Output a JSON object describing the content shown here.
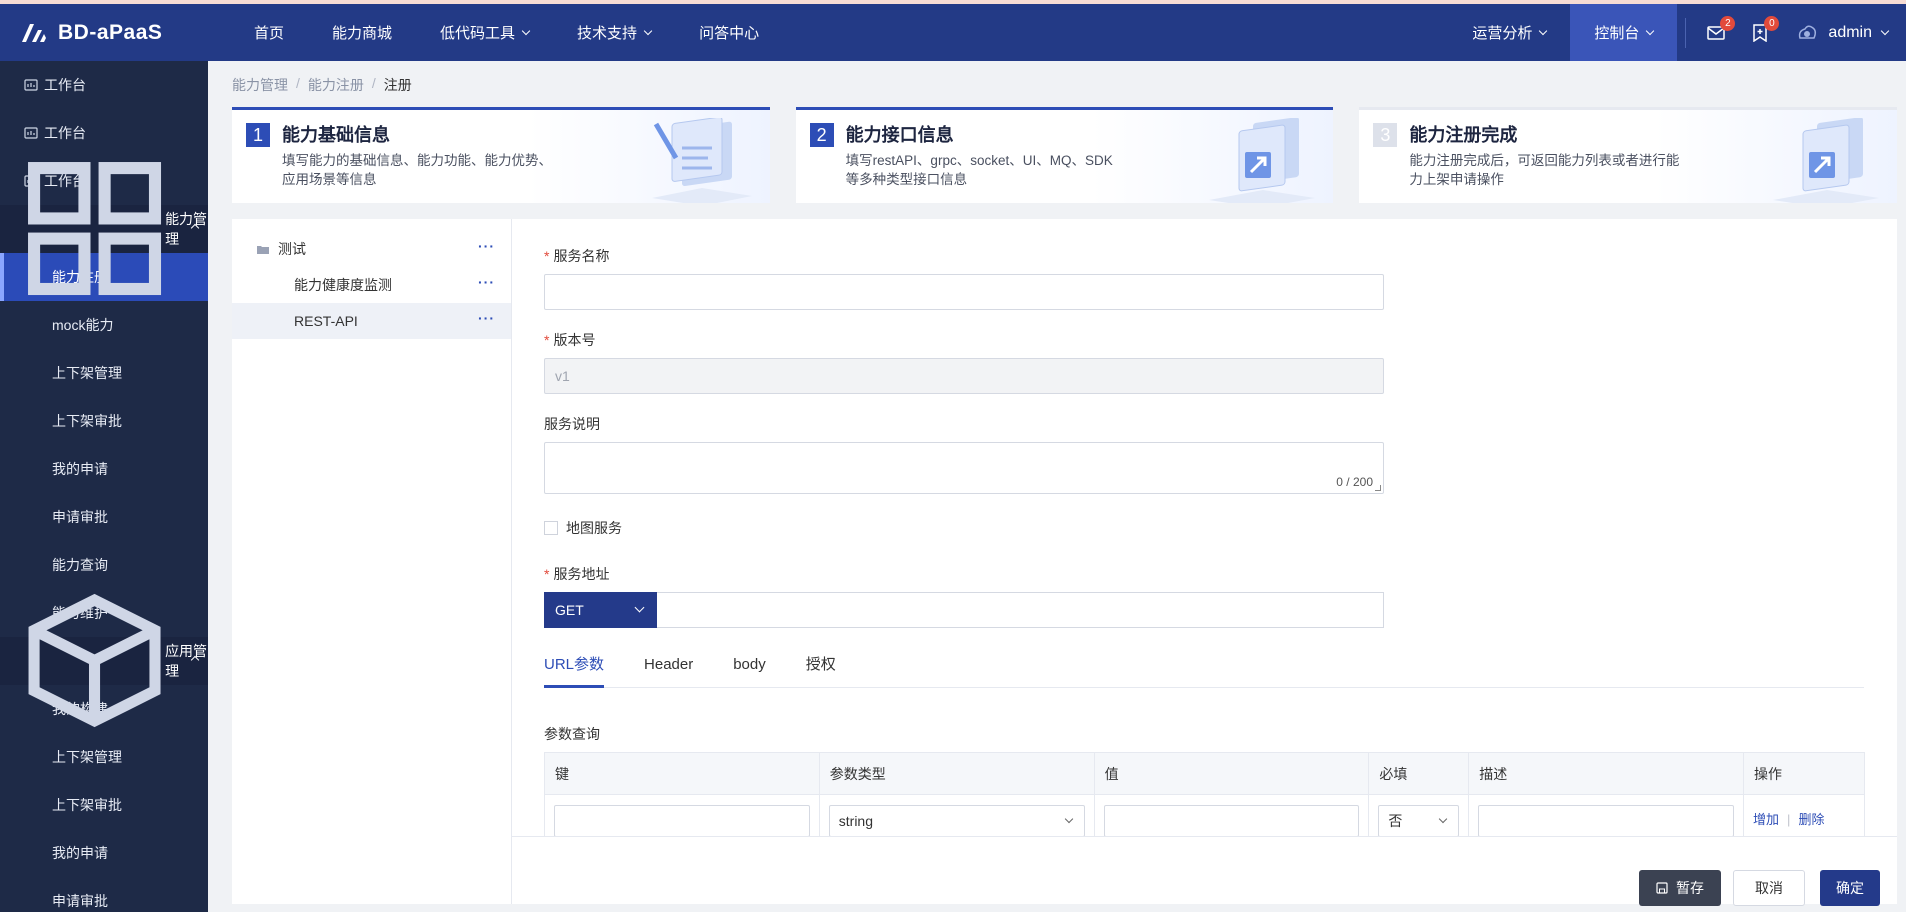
{
  "header": {
    "logo_text": "BD-aPaaS",
    "nav": [
      {
        "label": "首页",
        "has_dropdown": false
      },
      {
        "label": "能力商城",
        "has_dropdown": false
      },
      {
        "label": "低代码工具",
        "has_dropdown": true
      },
      {
        "label": "技术支持",
        "has_dropdown": true
      },
      {
        "label": "问答中心",
        "has_dropdown": false
      }
    ],
    "right": {
      "analysis": "运营分析",
      "console": "控制台",
      "mail_badge": "2",
      "notice_badge": "0",
      "user": "admin"
    }
  },
  "sidebar": {
    "top_items": [
      "工作台",
      "工作台",
      "工作台"
    ],
    "group1": {
      "label": "能力管理",
      "items": [
        "能力注册",
        "mock能力",
        "上下架管理",
        "上下架审批",
        "我的申请",
        "申请审批",
        "能力查询",
        "能力维护"
      ]
    },
    "group2": {
      "label": "应用管理",
      "items": [
        "我的构建",
        "上下架管理",
        "上下架审批",
        "我的申请",
        "申请审批"
      ]
    }
  },
  "breadcrumb": [
    "能力管理",
    "能力注册",
    "注册"
  ],
  "steps": [
    {
      "num": "1",
      "title": "能力基础信息",
      "desc": "填写能力的基础信息、能力功能、能力优势、应用场景等信息"
    },
    {
      "num": "2",
      "title": "能力接口信息",
      "desc": "填写restAPI、grpc、socket、UI、MQ、SDK等多种类型接口信息"
    },
    {
      "num": "3",
      "title": "能力注册完成",
      "desc": "能力注册完成后，可返回能力列表或者进行能力上架申请操作"
    }
  ],
  "tree": {
    "root": "测试",
    "children": [
      "能力健康度监测",
      "REST-API"
    ],
    "more": "···"
  },
  "form": {
    "service_name_label": "服务名称",
    "version_label": "版本号",
    "version_value": "v1",
    "desc_label": "服务说明",
    "desc_counter": "0 / 200",
    "map_service_label": "地图服务",
    "address_label": "服务地址",
    "method": "GET",
    "tabs": [
      "URL参数",
      "Header",
      "body",
      "授权"
    ],
    "param_section": "参数查询",
    "table_headers": [
      "键",
      "参数类型",
      "值",
      "必填",
      "描述",
      "操作"
    ],
    "row": {
      "type": "string",
      "required": "否",
      "add": "增加",
      "delete": "删除"
    }
  },
  "footer": {
    "save": "暂存",
    "cancel": "取消",
    "ok": "确定"
  },
  "colors": {
    "header_bg": "#233a86",
    "sidebar_bg": "#1e2a47",
    "active_blue": "#2b4bb8",
    "badge_red": "#e24a3b"
  }
}
